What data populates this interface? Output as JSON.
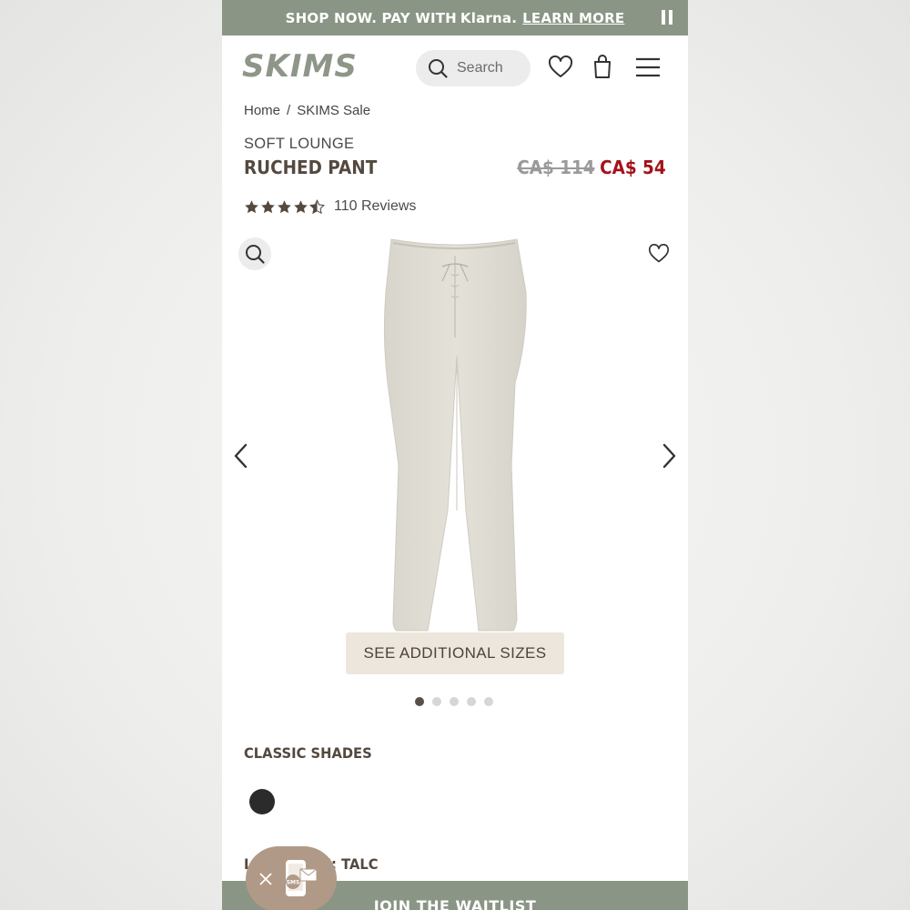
{
  "promo": {
    "text": "SHOP NOW. PAY WITH",
    "brand": "Klarna.",
    "link": "LEARN MORE",
    "pause_icon": "pause-icon"
  },
  "header": {
    "logo": "SKIMS",
    "search_placeholder": "Search",
    "icons": [
      "search-icon",
      "heart-icon",
      "shopping-bag-icon",
      "menu-icon"
    ]
  },
  "breadcrumb": {
    "items": [
      "Home",
      "SKIMS Sale"
    ],
    "separator": "/"
  },
  "product": {
    "category": "SOFT LOUNGE",
    "name": "RUCHED PANT",
    "original_price": "CA$ 114",
    "sale_price": "CA$ 54",
    "rating": 4.5,
    "reviews": "110 Reviews"
  },
  "gallery": {
    "sizes_button": "SEE ADDITIONAL SIZES",
    "image_count": 5,
    "active_index": 0,
    "icons": [
      "zoom-icon",
      "heart-icon",
      "chevron-left-icon",
      "chevron-right-icon"
    ]
  },
  "shades": {
    "label": "CLASSIC SHADES",
    "swatches": [
      {
        "color": "#2b2b2b"
      }
    ]
  },
  "collection": {
    "visible_text": "L           ION: TALC"
  },
  "footer": {
    "waitlist": "JOIN THE WAITLIST",
    "sms_label": "SMS"
  },
  "colors": {
    "sage": "#8a9585",
    "sale_red": "#a3121a",
    "brown_text": "#54493f",
    "sizes_bg": "#ede6dd",
    "bubble": "#b09a87"
  }
}
